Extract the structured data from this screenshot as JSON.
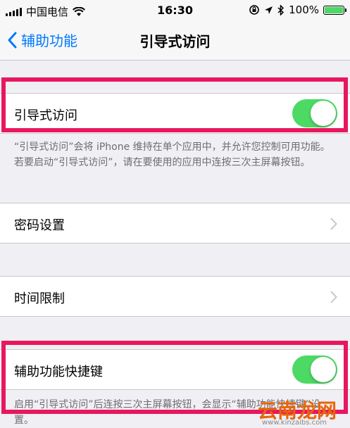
{
  "status": {
    "carrier": "中国电信",
    "time": "16:30",
    "battery": "100%",
    "battery_level": 100
  },
  "nav": {
    "back_label": "辅助功能",
    "title": "引导式访问"
  },
  "guided_access": {
    "label": "引导式访问",
    "enabled": true,
    "footer": "“引导式访问”会将 iPhone 维持在单个应用中，并允许您控制可用功能。若要启动“引导式访问”，请在要使用的应用中连按三次主屏幕按钮。"
  },
  "passcode": {
    "label": "密码设置"
  },
  "time_limits": {
    "label": "时间限制"
  },
  "accessibility_shortcut": {
    "label": "辅助功能快捷键",
    "enabled": true,
    "footer": "启用“引导式访问”后连按三次主屏幕按钮，会显示“辅助功能快捷键”设置。"
  },
  "watermark": {
    "brand": "云南龙网",
    "url": "www.kinzaibs.com"
  },
  "colors": {
    "accent": "#007aff",
    "toggle_on": "#4cd964",
    "highlight": "#e8175d"
  }
}
